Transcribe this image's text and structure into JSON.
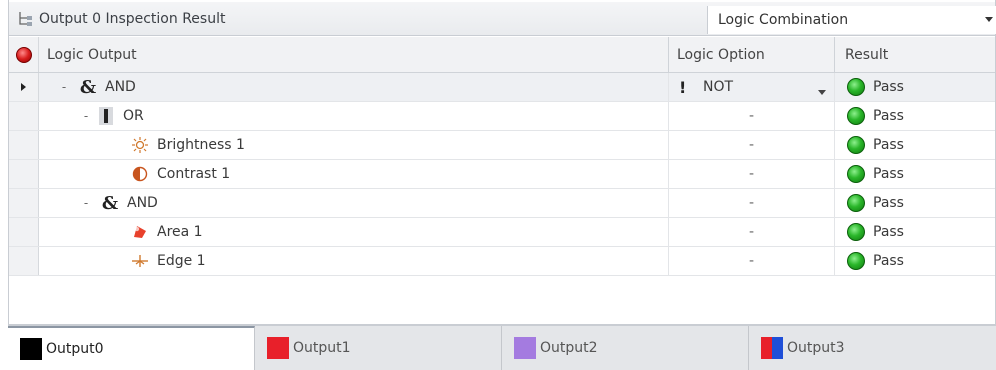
{
  "panel": {
    "title": "Output 0 Inspection Result",
    "combo_value": "Logic Combination"
  },
  "columns": {
    "logic_output": "Logic Output",
    "logic_option": "Logic Option",
    "result": "Result"
  },
  "rows": [
    {
      "label": "AND",
      "kind": "and",
      "option": "NOT",
      "result": "Pass"
    },
    {
      "label": "OR",
      "kind": "or",
      "option": "-",
      "result": "Pass"
    },
    {
      "label": "Brightness 1",
      "kind": "brightness",
      "option": "-",
      "result": "Pass"
    },
    {
      "label": "Contrast 1",
      "kind": "contrast",
      "option": "-",
      "result": "Pass"
    },
    {
      "label": "AND",
      "kind": "and",
      "option": "-",
      "result": "Pass"
    },
    {
      "label": "Area 1",
      "kind": "area",
      "option": "-",
      "result": "Pass"
    },
    {
      "label": "Edge 1",
      "kind": "edge",
      "option": "-",
      "result": "Pass"
    }
  ],
  "symbols": {
    "and": "&",
    "not": "!",
    "expand": "-"
  },
  "tabs": [
    {
      "label": "Output0",
      "color": "#000000"
    },
    {
      "label": "Output1",
      "color": "#e8202a"
    },
    {
      "label": "Output2",
      "color": "#a47be0"
    },
    {
      "label": "Output3",
      "color": "#e8202a",
      "color2": "#1f4fd8"
    }
  ],
  "colors": {
    "pass": "#2ab62a",
    "status_fail": "#d81d1d"
  }
}
